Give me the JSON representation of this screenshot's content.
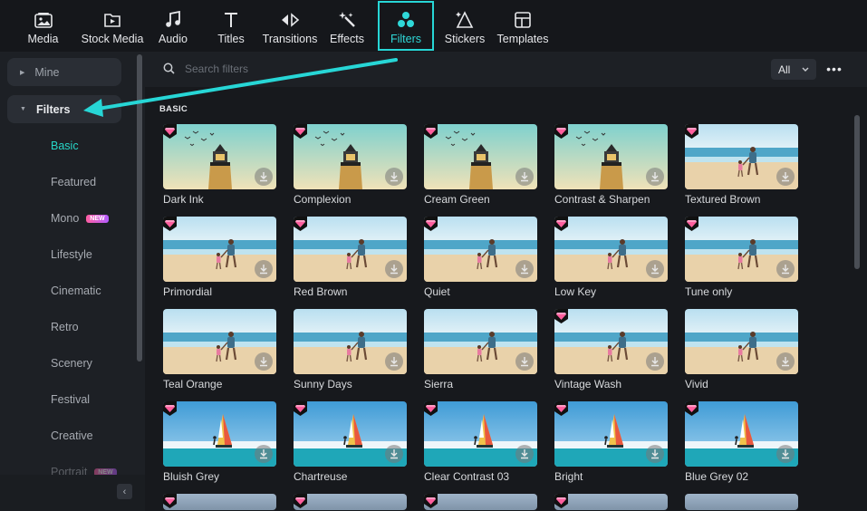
{
  "toolbar": {
    "items": [
      {
        "label": "Media",
        "icon": "media-icon"
      },
      {
        "label": "Stock Media",
        "icon": "stock-media-icon"
      },
      {
        "label": "Audio",
        "icon": "music-note-icon"
      },
      {
        "label": "Titles",
        "icon": "text-t-icon"
      },
      {
        "label": "Transitions",
        "icon": "transitions-icon"
      },
      {
        "label": "Effects",
        "icon": "effects-sparkle-icon"
      },
      {
        "label": "Filters",
        "icon": "filters-circles-icon",
        "active": true
      },
      {
        "label": "Stickers",
        "icon": "stickers-icon"
      },
      {
        "label": "Templates",
        "icon": "templates-icon"
      }
    ]
  },
  "sidebar": {
    "groups": [
      {
        "label": "Mine",
        "open": false
      },
      {
        "label": "Filters",
        "open": true
      }
    ],
    "items": [
      {
        "label": "Basic",
        "active": true
      },
      {
        "label": "Featured"
      },
      {
        "label": "Mono",
        "badge": "NEW"
      },
      {
        "label": "Lifestyle"
      },
      {
        "label": "Cinematic"
      },
      {
        "label": "Retro"
      },
      {
        "label": "Scenery"
      },
      {
        "label": "Festival"
      },
      {
        "label": "Creative"
      },
      {
        "label": "Portrait",
        "badge": "NEW"
      }
    ],
    "collapse_glyph": "‹"
  },
  "search": {
    "placeholder": "Search filters",
    "filter_value": "All",
    "more_glyph": "•••"
  },
  "section": {
    "title": "BASIC"
  },
  "filters": [
    {
      "name": "Dark Ink",
      "scene": "lighthouse",
      "premium": true
    },
    {
      "name": "Complexion",
      "scene": "lighthouse",
      "premium": true
    },
    {
      "name": "Cream Green",
      "scene": "lighthouse",
      "premium": true
    },
    {
      "name": "Contrast & Sharpen",
      "scene": "lighthouse",
      "premium": true
    },
    {
      "name": "Textured Brown",
      "scene": "beach",
      "premium": true
    },
    {
      "name": "Primordial",
      "scene": "beach",
      "premium": true
    },
    {
      "name": "Red Brown",
      "scene": "beach",
      "premium": true
    },
    {
      "name": "Quiet",
      "scene": "beach",
      "premium": true
    },
    {
      "name": "Low Key",
      "scene": "beach",
      "premium": true
    },
    {
      "name": "Tune only",
      "scene": "beach",
      "premium": true
    },
    {
      "name": "Teal Orange",
      "scene": "beach",
      "premium": false
    },
    {
      "name": "Sunny Days",
      "scene": "beach",
      "premium": false
    },
    {
      "name": "Sierra",
      "scene": "beach",
      "premium": false
    },
    {
      "name": "Vintage Wash",
      "scene": "beach",
      "premium": true
    },
    {
      "name": "Vivid",
      "scene": "beach",
      "premium": false
    },
    {
      "name": "Bluish Grey",
      "scene": "sail",
      "premium": true
    },
    {
      "name": "Chartreuse",
      "scene": "sail",
      "premium": true
    },
    {
      "name": "Clear Contrast 03",
      "scene": "sail",
      "premium": true
    },
    {
      "name": "Bright",
      "scene": "sail",
      "premium": true
    },
    {
      "name": "Blue Grey 02",
      "scene": "sail",
      "premium": true
    }
  ],
  "colors": {
    "accent": "#27d6d6",
    "active_text": "#27d6c8",
    "background": "#17191d",
    "sidebar": "#1d2025",
    "premium_gem": "#ff5f9e"
  }
}
